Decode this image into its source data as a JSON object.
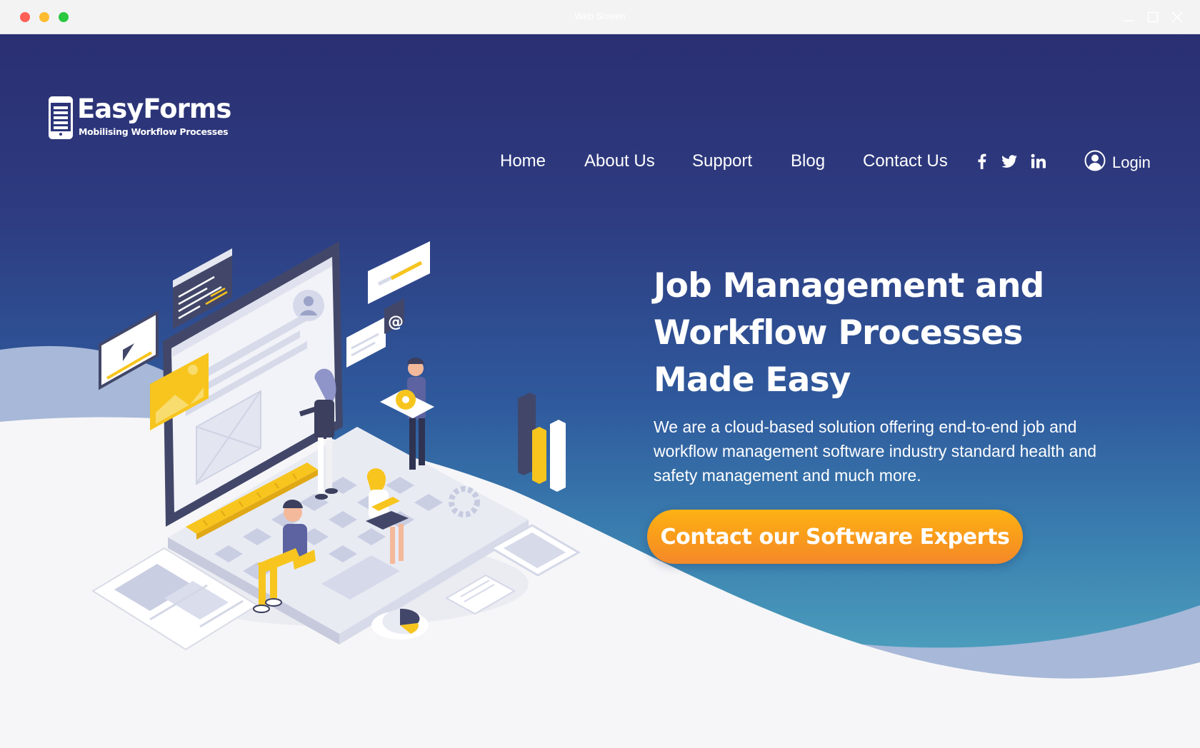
{
  "window": {
    "title": "Web Screen"
  },
  "brand": {
    "name": "EasyForms",
    "tagline": "Mobilising Workflow Processes"
  },
  "nav": {
    "items": [
      {
        "label": "Home"
      },
      {
        "label": "About Us"
      },
      {
        "label": "Support"
      },
      {
        "label": "Blog"
      },
      {
        "label": "Contact Us"
      }
    ],
    "social": [
      "facebook-icon",
      "twitter-icon",
      "linkedin-icon"
    ],
    "login_label": "Login"
  },
  "hero": {
    "title_lines": [
      "Job Management and",
      "Workflow Processes",
      "Made Easy"
    ],
    "description": "We are a cloud-based solution offering end-to-end job and workflow management software industry standard health and safety management and much more.",
    "cta_label": "Contact our Software Experts"
  },
  "colors": {
    "hero_gradient_top": "#2a2f72",
    "hero_gradient_bottom": "#4b9cbc",
    "wave_light": "#f6f6f8",
    "wave_blue": "#9bb2d6",
    "cta_orange": "#f99a1c",
    "accent_yellow": "#f7c51e"
  }
}
